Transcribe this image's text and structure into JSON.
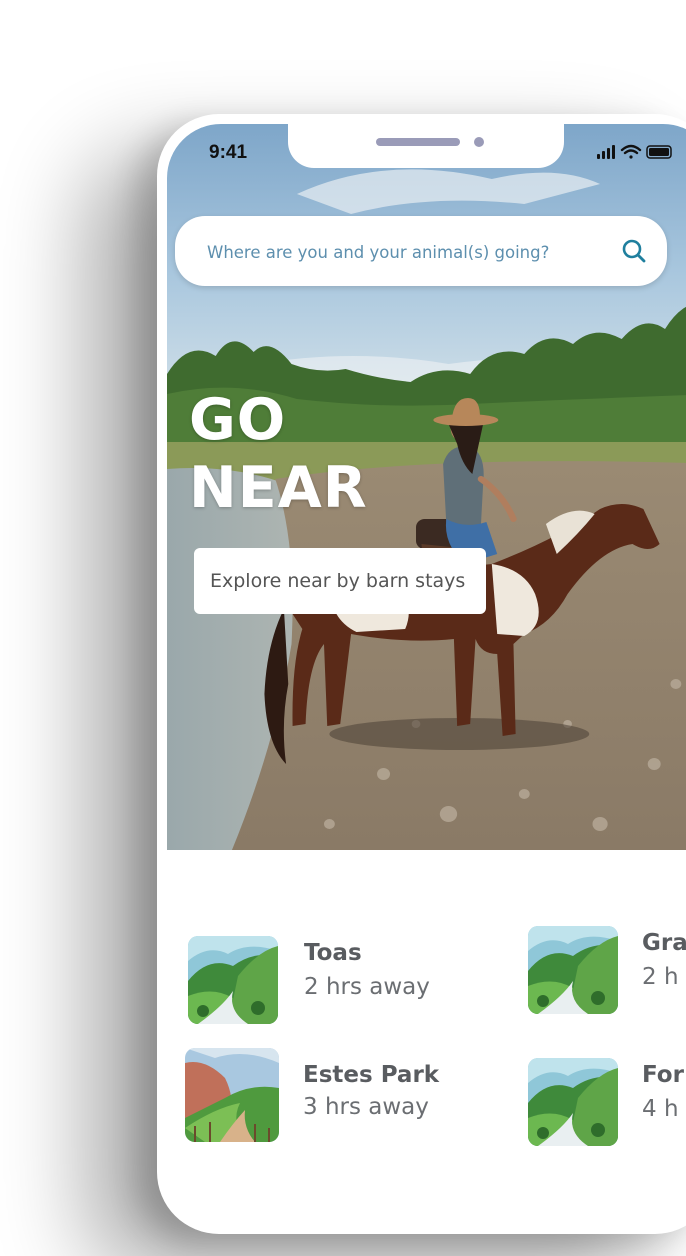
{
  "status_bar": {
    "time": "9:41"
  },
  "search": {
    "placeholder": "Where are you and your animal(s) going?"
  },
  "hero": {
    "headline_line1": "GO",
    "headline_line2": "NEAR",
    "cta_label": "Explore near by barn stays"
  },
  "destinations": [
    {
      "name": "Toas",
      "distance": "2 hrs away",
      "thumb": "valley-thumbnail"
    },
    {
      "name": "Gra",
      "distance": "2 h",
      "thumb": "valley-thumbnail"
    },
    {
      "name": "Estes Park",
      "distance": "3 hrs away",
      "thumb": "red-rock-thumbnail"
    },
    {
      "name": "For",
      "distance": "4 h",
      "thumb": "valley-thumbnail"
    }
  ],
  "colors": {
    "search_text": "#5d8fae",
    "search_icon": "#1f7f9e",
    "dest_title": "#595c60",
    "dest_subtitle": "#6b6e72"
  }
}
